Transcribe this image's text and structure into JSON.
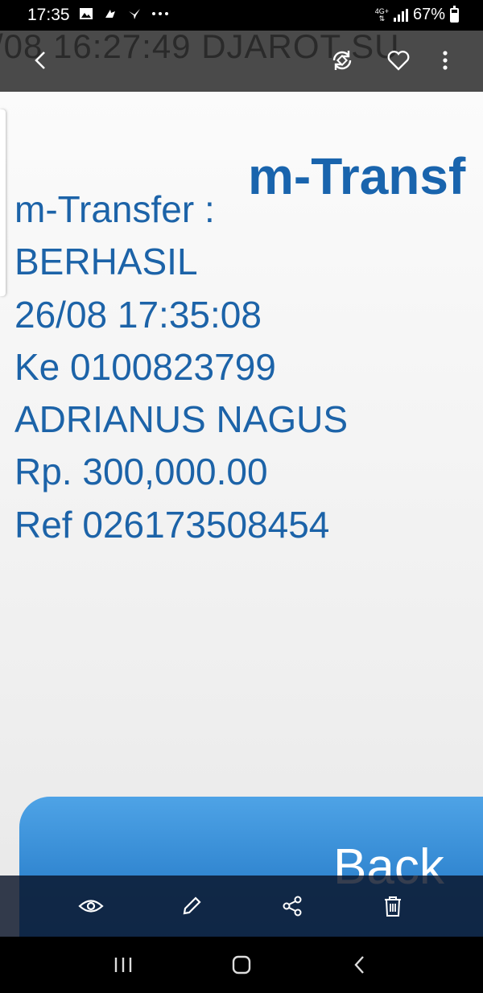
{
  "status_bar": {
    "time": "17:35",
    "network": "4G+",
    "battery": "67%",
    "left_icons": [
      "image-icon",
      "cloud-icon",
      "bird-icon",
      "more-dots-icon"
    ]
  },
  "viewer": {
    "watermark": "/08 16:27:49 DJAROT SU",
    "top_actions": [
      "back-arrow-icon",
      "rotate-icon",
      "heart-icon",
      "more-vert-icon"
    ],
    "bottom_actions": [
      "eye-icon",
      "pencil-icon",
      "share-icon",
      "trash-icon"
    ]
  },
  "photo": {
    "header_title": "m-Transf",
    "receipt_lines": [
      "m-Transfer :",
      "BERHASIL",
      "26/08 17:35:08",
      "Ke 0100823799",
      "ADRIANUS NAGUS",
      "Rp. 300,000.00",
      "Ref 026173508454"
    ],
    "back_button_label": "Back",
    "colors": {
      "text": "#1c63a8",
      "button": "#2f84cf"
    }
  },
  "nav_bar": [
    "recents-icon",
    "home-icon",
    "back-icon"
  ]
}
